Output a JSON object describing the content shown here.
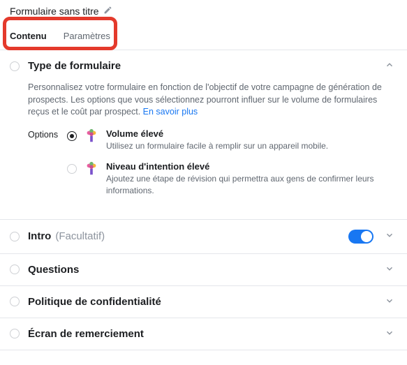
{
  "header": {
    "title": "Formulaire sans titre"
  },
  "tabs": {
    "content": "Contenu",
    "settings": "Paramètres"
  },
  "formType": {
    "title": "Type de formulaire",
    "description": "Personnalisez votre formulaire en fonction de l'objectif de votre campagne de génération de prospects. Les options que vous sélectionnez pourront influer sur le volume de formulaires reçus et le coût par prospect. ",
    "learnMore": "En savoir plus",
    "optionsLabel": "Options",
    "option1": {
      "title": "Volume élevé",
      "desc": "Utilisez un formulaire facile à remplir sur un appareil mobile."
    },
    "option2": {
      "title": "Niveau d'intention élevé",
      "desc": "Ajoutez une étape de révision qui permettra aux gens de confirmer leurs informations."
    }
  },
  "sections": {
    "intro": {
      "title": "Intro",
      "suffix": "(Facultatif)"
    },
    "questions": {
      "title": "Questions"
    },
    "privacy": {
      "title": "Politique de confidentialité"
    },
    "thankyou": {
      "title": "Écran de remerciement"
    }
  }
}
